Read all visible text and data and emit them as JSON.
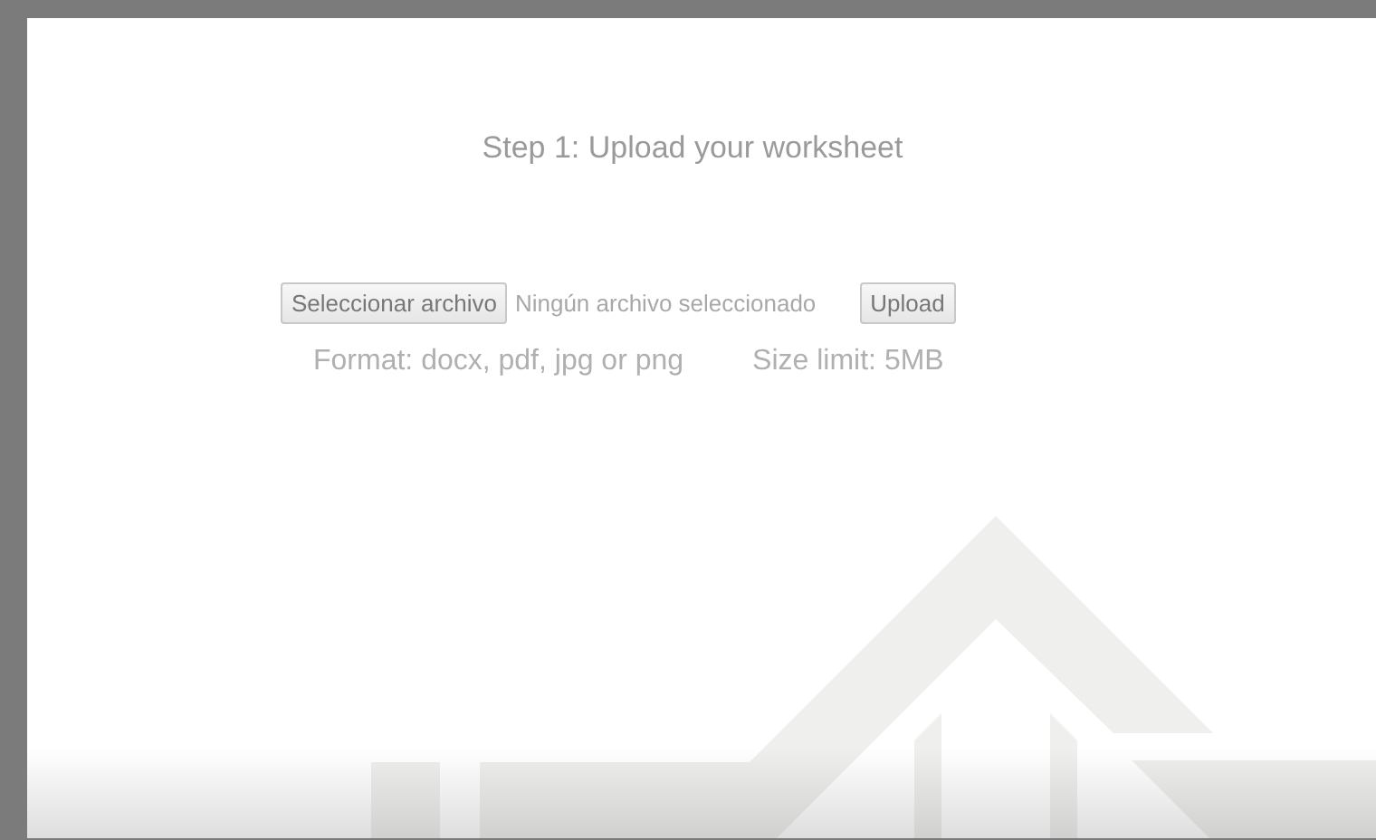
{
  "heading": "Step 1: Upload your worksheet",
  "file_input": {
    "button": "Seleccionar archivo",
    "status": "Ningún archivo seleccionado"
  },
  "upload_button": "Upload",
  "format_note": "Format: docx, pdf, jpg or png",
  "size_note": "Size limit: 5MB"
}
